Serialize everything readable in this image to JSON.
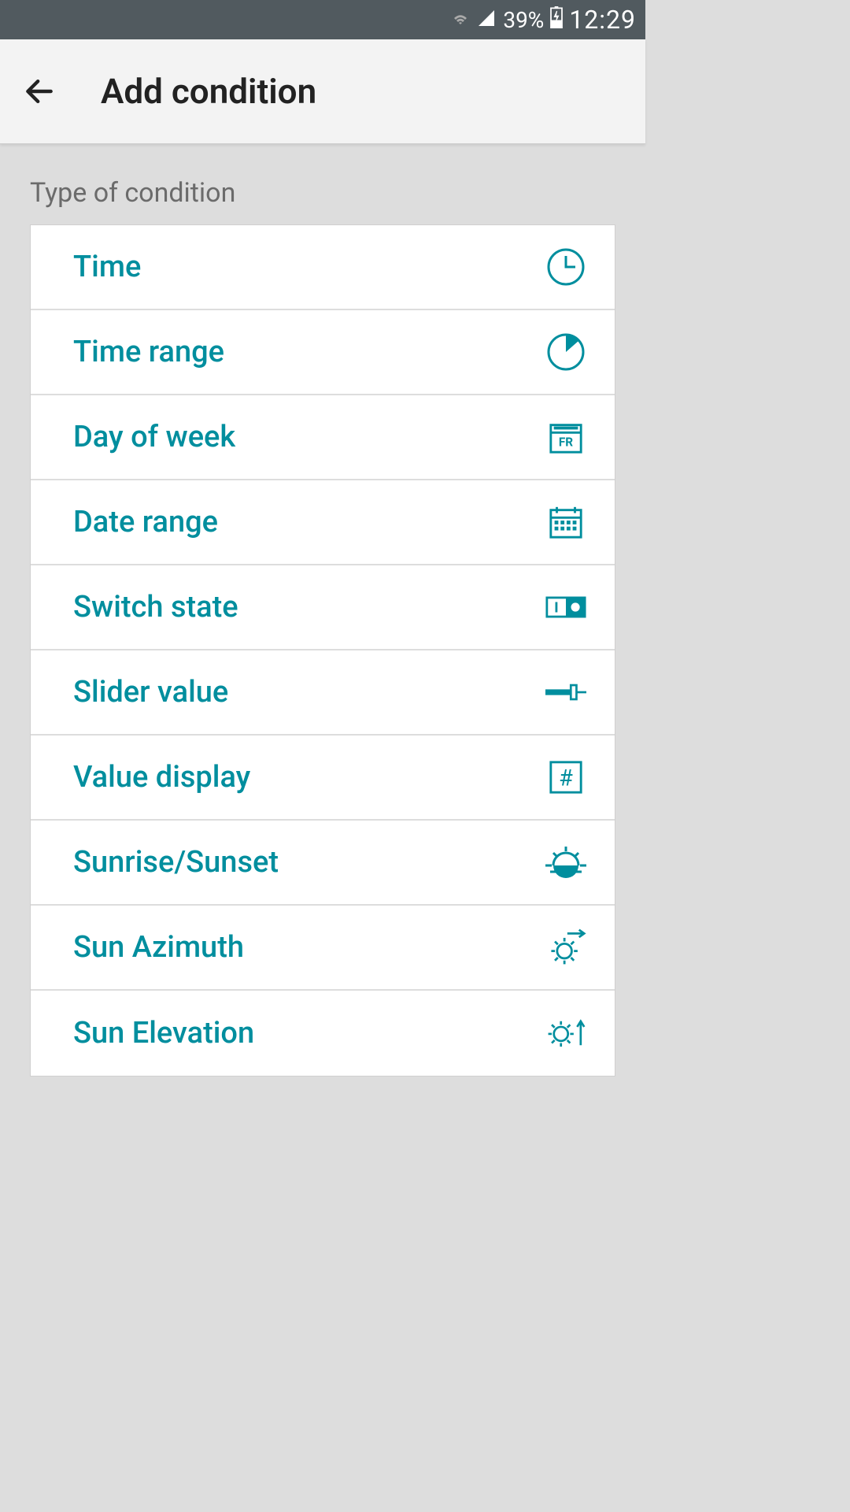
{
  "status": {
    "battery": "39%",
    "time": "12:29"
  },
  "header": {
    "title": "Add condition"
  },
  "section": {
    "label": "Type of condition"
  },
  "items": [
    {
      "label": "Time",
      "icon": "clock-icon"
    },
    {
      "label": "Time range",
      "icon": "clock-partial-icon"
    },
    {
      "label": "Day of week",
      "icon": "calendar-day-icon"
    },
    {
      "label": "Date range",
      "icon": "calendar-grid-icon"
    },
    {
      "label": "Switch state",
      "icon": "switch-icon"
    },
    {
      "label": "Slider value",
      "icon": "slider-icon"
    },
    {
      "label": "Value display",
      "icon": "hash-icon"
    },
    {
      "label": "Sunrise/Sunset",
      "icon": "sunrise-icon"
    },
    {
      "label": "Sun Azimuth",
      "icon": "sun-azimuth-icon"
    },
    {
      "label": "Sun Elevation",
      "icon": "sun-elevation-icon"
    }
  ],
  "colors": {
    "accent": "#008e9e",
    "statusbar": "#515a5f",
    "background": "#ddd"
  }
}
